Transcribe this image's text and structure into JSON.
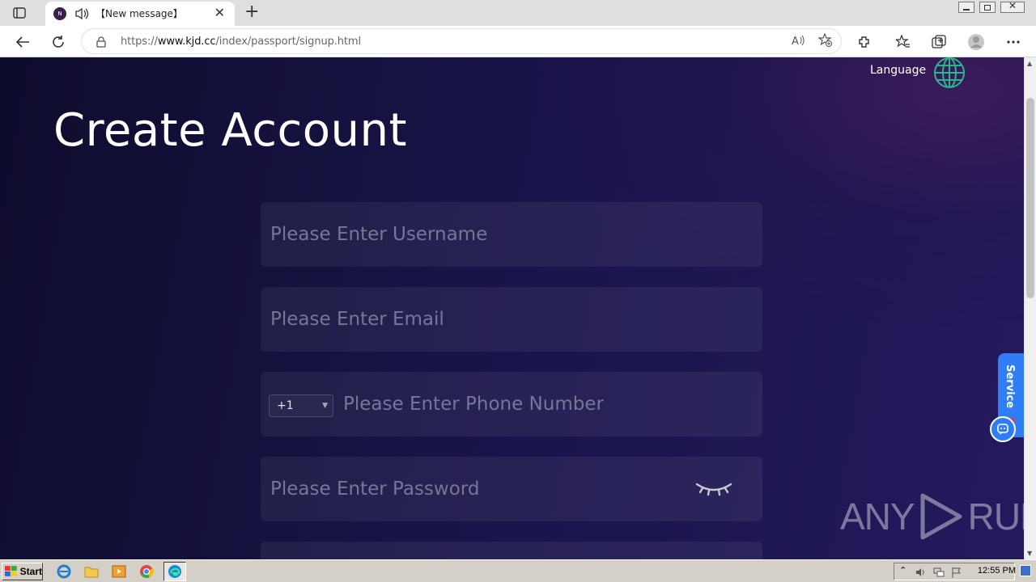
{
  "browser": {
    "tab_title": "【New message】",
    "tab_favicon_letter": "N",
    "url_prefix": "https://",
    "url_host": "www.kjd.cc",
    "url_path": "/index/passport/signup.html"
  },
  "page": {
    "language_label": "Language",
    "title": "Create Account",
    "fields": {
      "username_placeholder": "Please Enter Username",
      "email_placeholder": "Please Enter Email",
      "country_code": "+1",
      "phone_placeholder": "Please Enter Phone Number",
      "password_placeholder": "Please Enter Password"
    },
    "service_label": "Service"
  },
  "watermark": {
    "left": "ANY",
    "right": "RUN"
  },
  "taskbar": {
    "start_label": "Start",
    "clock": "12:55 PM"
  },
  "colors": {
    "page_bg_dark": "#0e0c2c",
    "page_bg_accent": "#231a5e",
    "globe": "#2bb58a",
    "service": "#2f7ef5"
  }
}
